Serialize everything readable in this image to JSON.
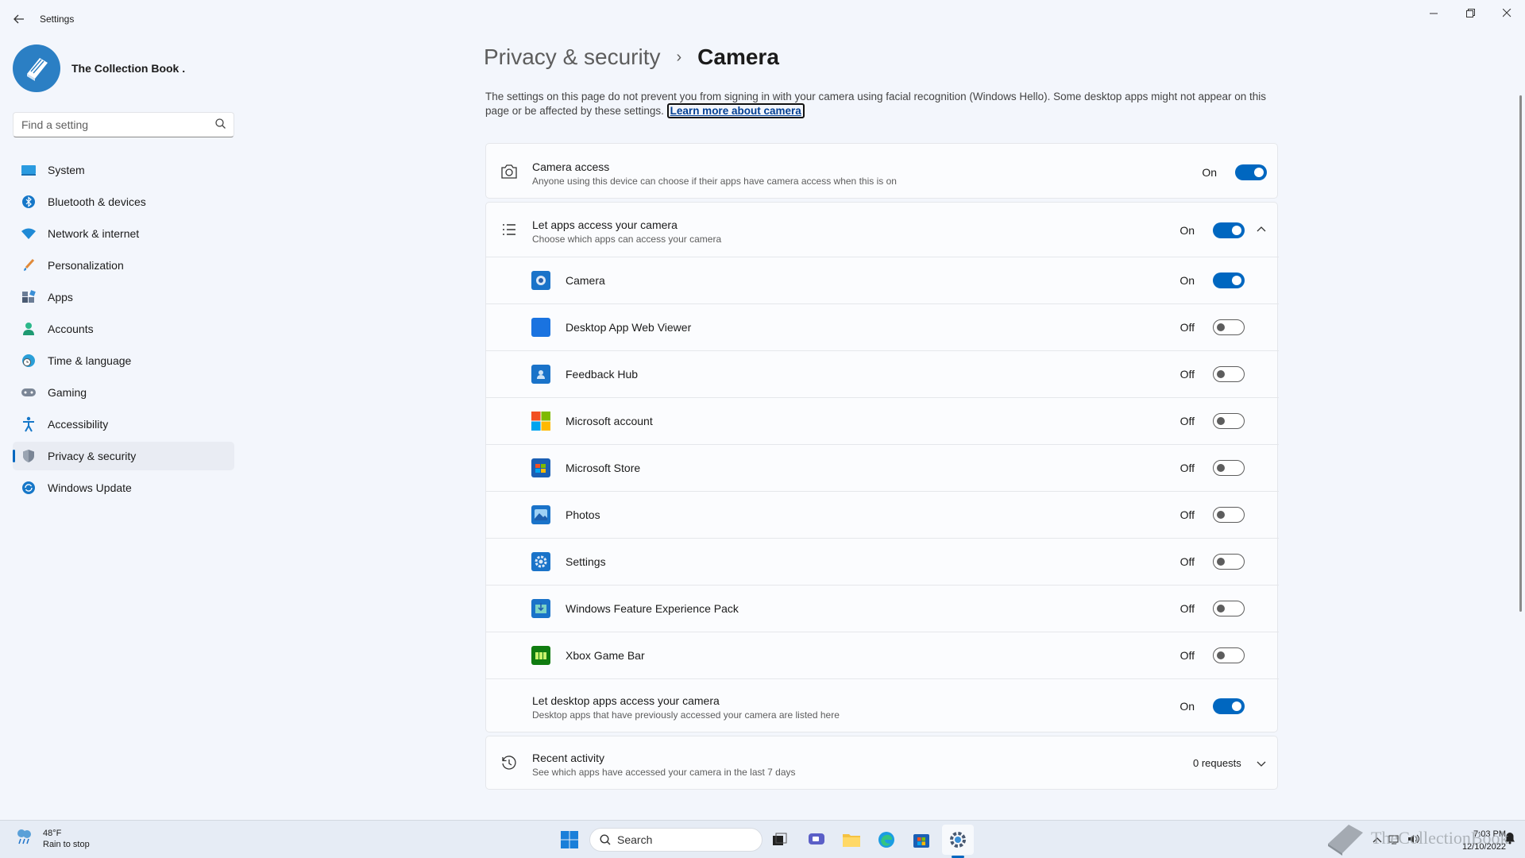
{
  "window": {
    "title": "Settings",
    "back_icon": "arrow-left-icon",
    "controls": [
      "minimize",
      "restore",
      "close"
    ]
  },
  "profile": {
    "name": "The Collection Book ."
  },
  "search": {
    "placeholder": "Find a setting"
  },
  "sidebar": {
    "items": [
      {
        "label": "System",
        "icon": "monitor-icon",
        "active": false
      },
      {
        "label": "Bluetooth & devices",
        "icon": "bluetooth-icon",
        "active": false
      },
      {
        "label": "Network & internet",
        "icon": "wifi-icon",
        "active": false
      },
      {
        "label": "Personalization",
        "icon": "brush-icon",
        "active": false
      },
      {
        "label": "Apps",
        "icon": "apps-icon",
        "active": false
      },
      {
        "label": "Accounts",
        "icon": "person-icon",
        "active": false
      },
      {
        "label": "Time & language",
        "icon": "globe-clock-icon",
        "active": false
      },
      {
        "label": "Gaming",
        "icon": "gamepad-icon",
        "active": false
      },
      {
        "label": "Accessibility",
        "icon": "accessibility-icon",
        "active": false
      },
      {
        "label": "Privacy & security",
        "icon": "shield-icon",
        "active": true
      },
      {
        "label": "Windows Update",
        "icon": "update-icon",
        "active": false
      }
    ]
  },
  "breadcrumb": {
    "parent": "Privacy & security",
    "separator": "›",
    "current": "Camera"
  },
  "description": {
    "text": "The settings on this page do not prevent you from signing in with your camera using facial recognition (Windows Hello). Some desktop apps might not appear on this page or be affected by these settings.",
    "link": "Learn more about camera"
  },
  "camera_access": {
    "title": "Camera access",
    "subtitle": "Anyone using this device can choose if their apps have camera access when this is on",
    "state": "On"
  },
  "apps_access": {
    "title": "Let apps access your camera",
    "subtitle": "Choose which apps can access your camera",
    "state": "On",
    "apps": [
      {
        "name": "Camera",
        "state": "On",
        "icon": "camera-app-icon"
      },
      {
        "name": "Desktop App Web Viewer",
        "state": "Off",
        "icon": "web-viewer-icon"
      },
      {
        "name": "Feedback Hub",
        "state": "Off",
        "icon": "feedback-hub-icon"
      },
      {
        "name": "Microsoft account",
        "state": "Off",
        "icon": "microsoft-logo-icon"
      },
      {
        "name": "Microsoft Store",
        "state": "Off",
        "icon": "store-icon"
      },
      {
        "name": "Photos",
        "state": "Off",
        "icon": "photos-icon"
      },
      {
        "name": "Settings",
        "state": "Off",
        "icon": "settings-gear-icon"
      },
      {
        "name": "Windows Feature Experience Pack",
        "state": "Off",
        "icon": "feature-pack-icon"
      },
      {
        "name": "Xbox Game Bar",
        "state": "Off",
        "icon": "xbox-game-bar-icon"
      }
    ],
    "desktop": {
      "title": "Let desktop apps access your camera",
      "subtitle": "Desktop apps that have previously accessed your camera are listed here",
      "state": "On"
    }
  },
  "recent_activity": {
    "title": "Recent activity",
    "subtitle": "See which apps have accessed your camera in the last 7 days",
    "value": "0 requests"
  },
  "taskbar": {
    "weather_temp": "48°F",
    "weather_desc": "Rain to stop",
    "search_label": "Search",
    "time": "7:03 PM",
    "date": "12/10/2022",
    "watermark": "TheCollectionBook"
  },
  "colors": {
    "accent": "#0067c0",
    "background": "#f3f6fc",
    "card": "#fbfcfe"
  }
}
